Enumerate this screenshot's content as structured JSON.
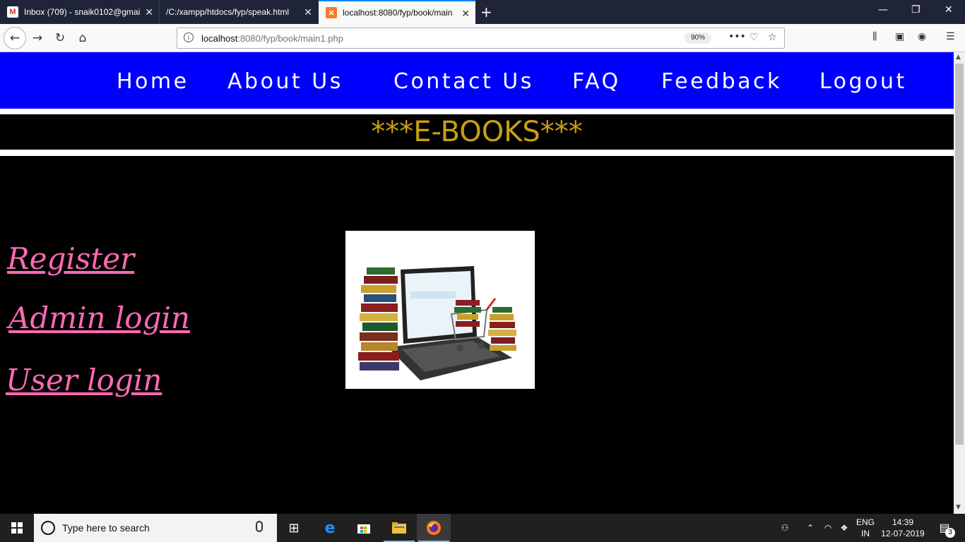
{
  "browser": {
    "tabs": [
      {
        "title": "Inbox (709) - snaik0102@gmail.",
        "favicon": "gmail-icon",
        "active": false
      },
      {
        "title": "/C:/xampp/htdocs/fyp/speak.html",
        "favicon": "",
        "active": false
      },
      {
        "title": "localhost:8080/fyp/book/main",
        "favicon": "xampp-icon",
        "active": true
      }
    ],
    "url_host": "localhost",
    "url_rest": ":8080/fyp/book/main1.php",
    "zoom": "90%"
  },
  "site": {
    "nav": [
      "Home",
      "About Us",
      "Contact Us",
      "FAQ",
      "Feedback",
      "Logout"
    ],
    "banner": "***E-BOOKS***",
    "links": [
      "Register",
      "Admin login",
      "User login"
    ],
    "colors": {
      "nav_bg": "#0000ff",
      "banner_text": "#c8a010",
      "link": "#ff69b4"
    }
  },
  "taskbar": {
    "search_placeholder": "Type here to search",
    "lang": "ENG",
    "region": "IN",
    "time": "14:39",
    "date": "12-07-2019",
    "notifications": "3"
  }
}
